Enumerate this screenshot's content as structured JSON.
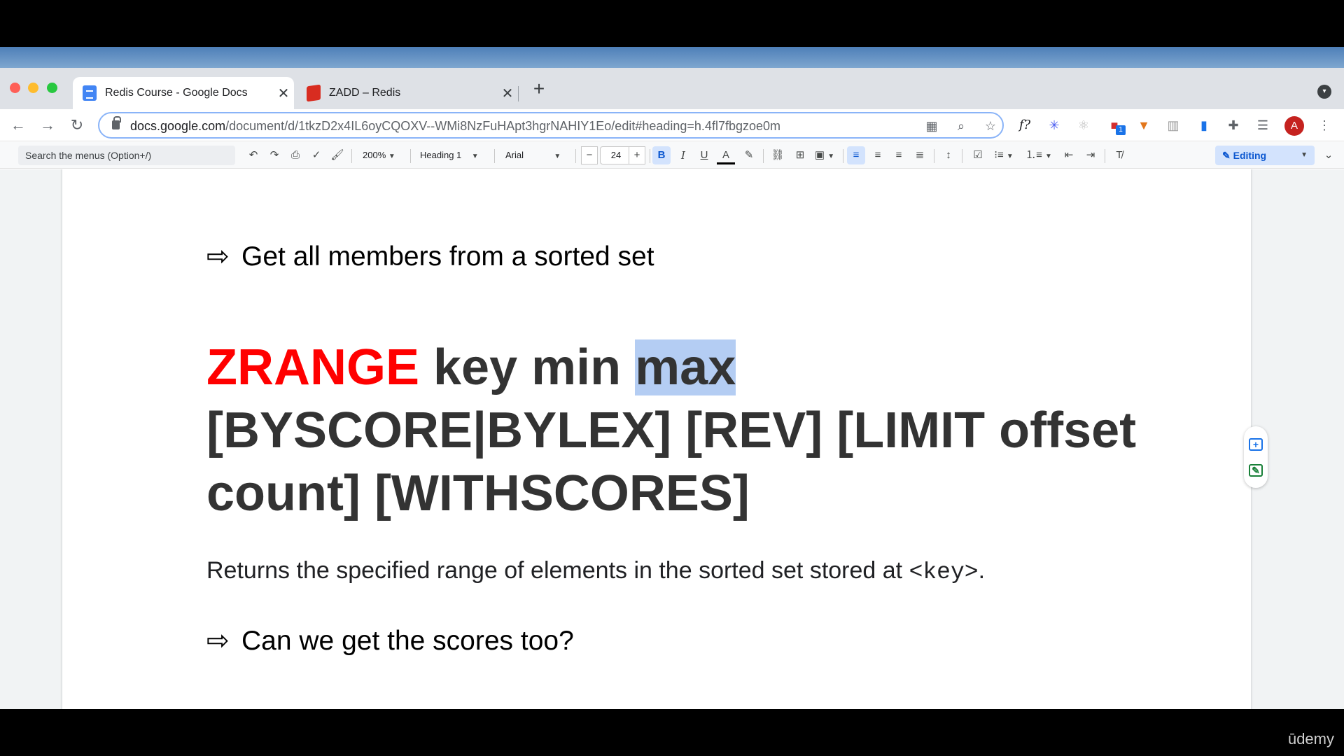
{
  "browser": {
    "tabs": [
      {
        "title": "Redis Course - Google Docs",
        "favicon": "google-docs-icon",
        "close": "✕"
      },
      {
        "title": "ZADD – Redis",
        "favicon": "redis-icon",
        "close": "✕"
      }
    ],
    "new_tab": "+",
    "url_host": "docs.google.com",
    "url_path": "/document/d/1tkzD2x4IL6oyCQOXV--WMi8NzFuHApt3hgrNAHIY1Eo/edit#heading=h.4fl7fbgzoe0m",
    "extensions": [
      "function-icon",
      "snowflake-icon",
      "react-icon",
      "extension-badge-icon",
      "metamask-icon",
      "chart-icon",
      "book-icon",
      "puzzle-icon",
      "media-icon"
    ],
    "extension_badge": "1",
    "extension_function_label": "f?",
    "avatar_letter": "A"
  },
  "docs_toolbar": {
    "menu_search_placeholder": "Search the menus (Option+/)",
    "zoom": "200%",
    "style": "Heading 1",
    "font": "Arial",
    "font_size": "24",
    "font_size_minus": "−",
    "font_size_plus": "+",
    "bold": "B",
    "italic": "I",
    "underline": "U",
    "text_color": "A",
    "mode": "Editing"
  },
  "document": {
    "heading1": "Get all members from a sorted set",
    "command_keyword": "ZRANGE",
    "command_rest_1": " key min ",
    "command_selected": "max",
    "command_line_2": "[BYSCORE|BYLEX] [REV] [LIMIT offset",
    "command_line_3": "count] [WITHSCORES]",
    "description_prefix": "Returns the specified range of elements in the sorted set stored at ",
    "description_code": "<key>",
    "description_suffix": ".",
    "heading2": "Can we get the scores too?",
    "arrow": "⇨"
  },
  "watermark": "ūdemy",
  "colors": {
    "keyword": "#ff0000",
    "selection": "#b4cdf3",
    "accent": "#0b57d0"
  }
}
